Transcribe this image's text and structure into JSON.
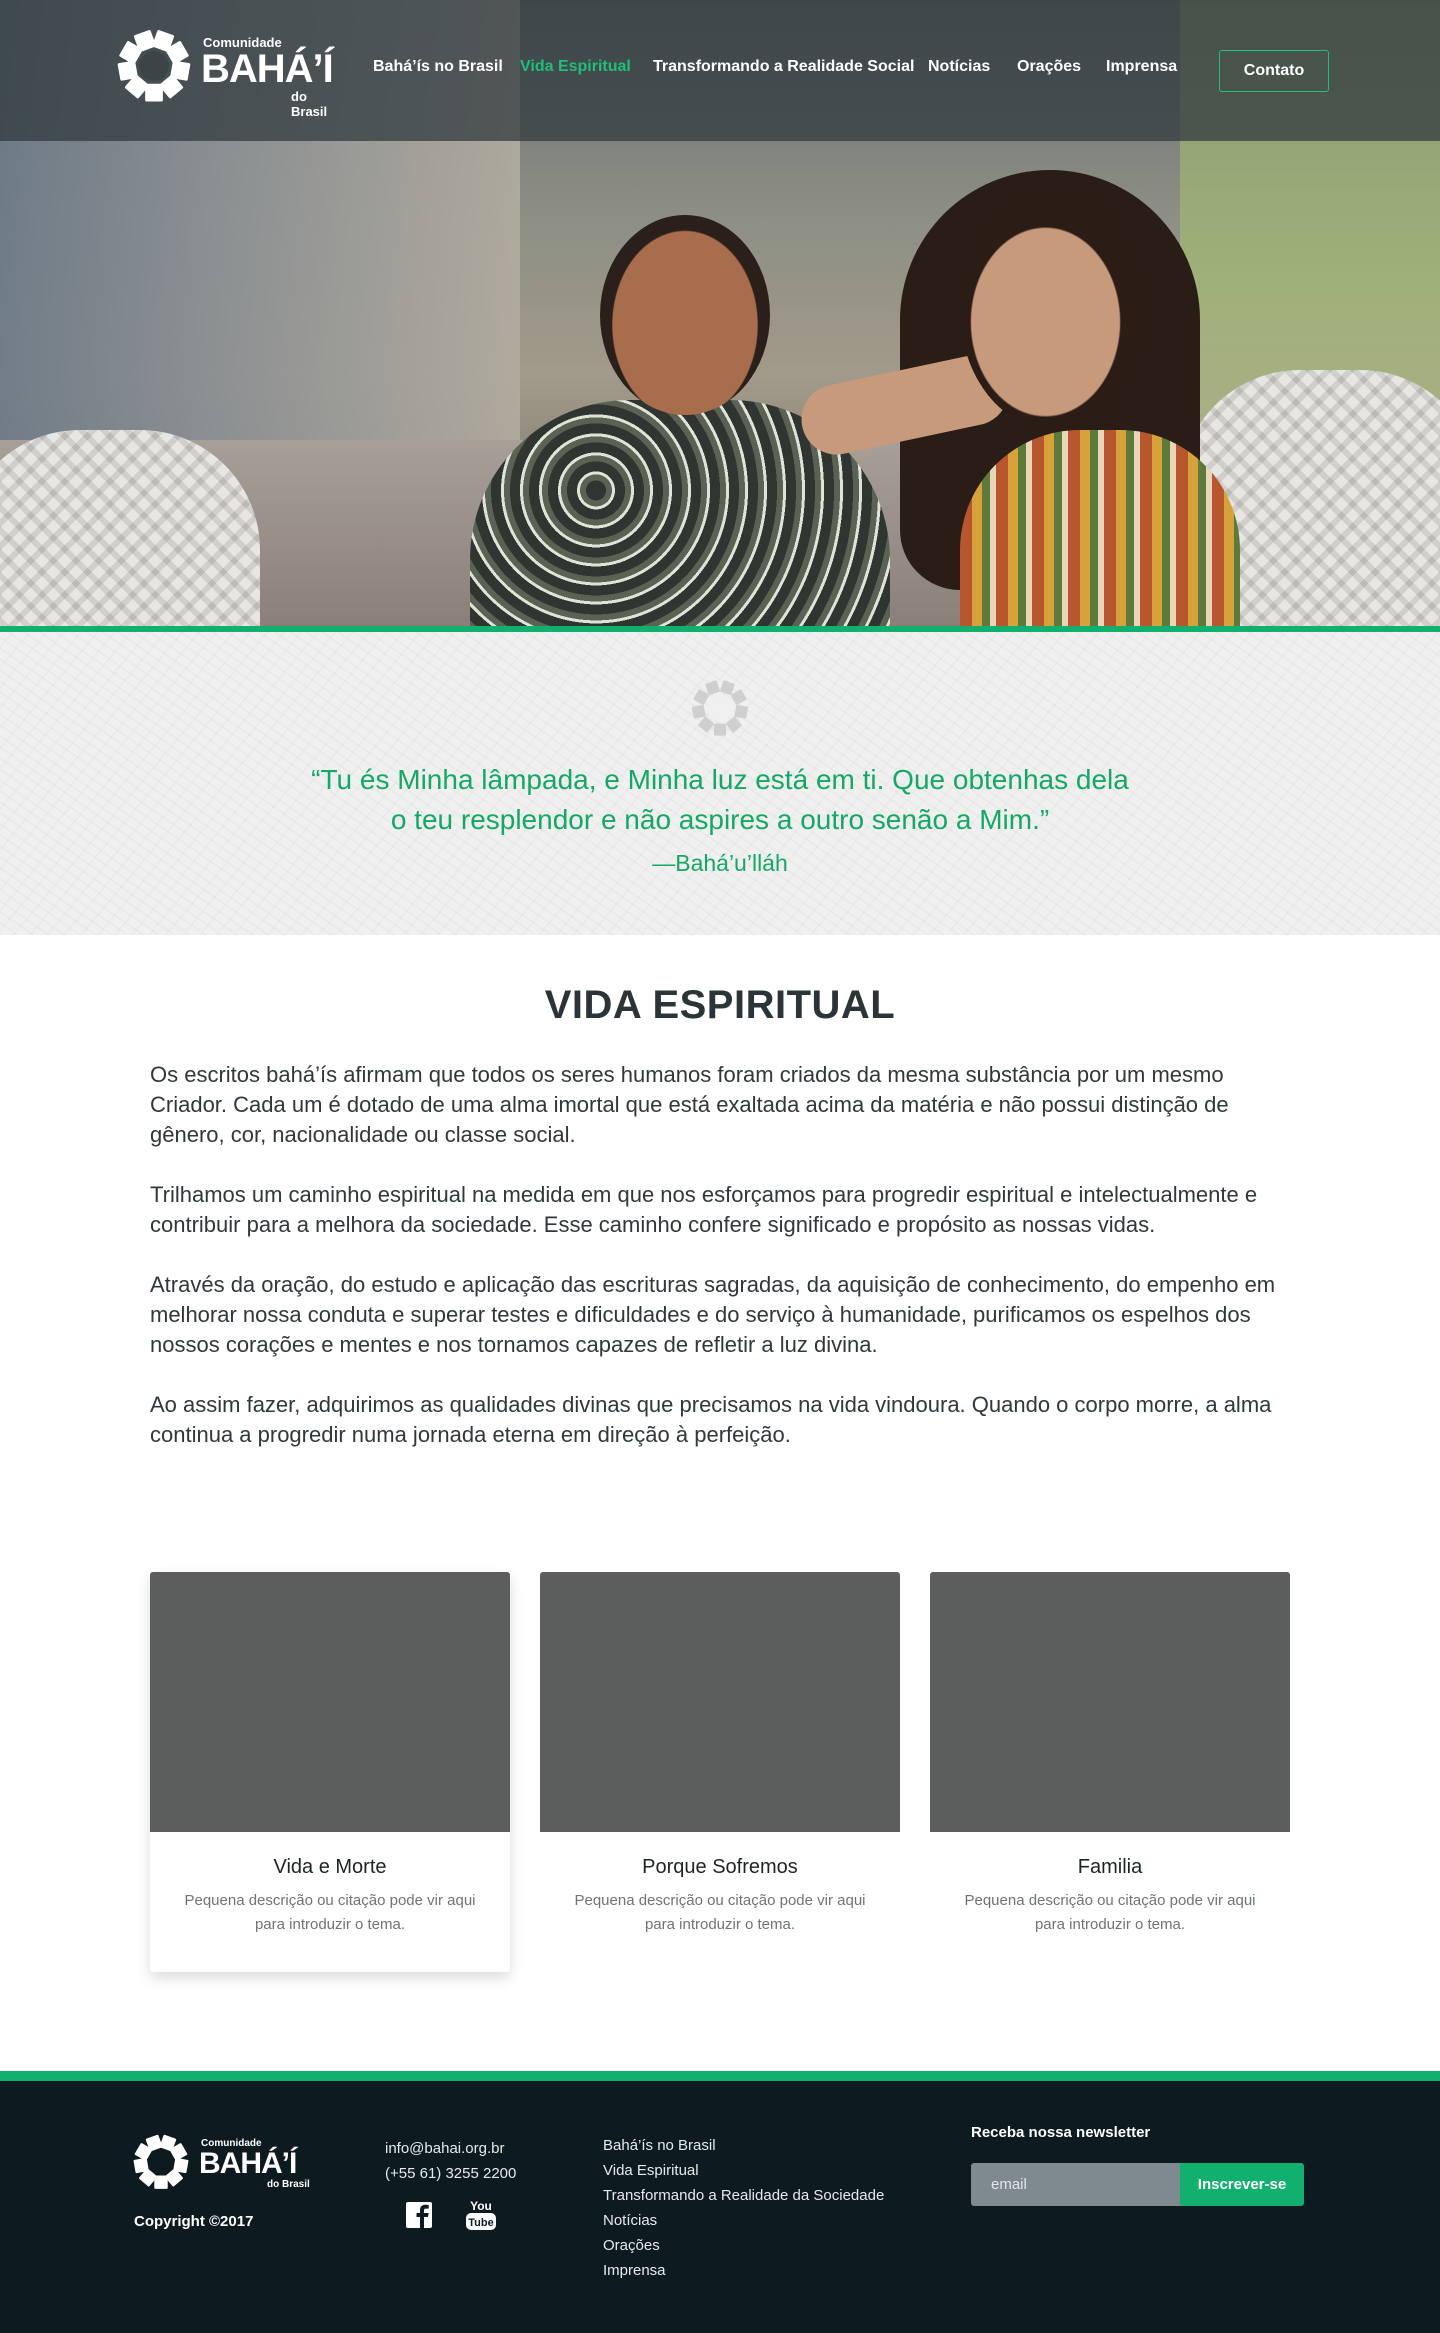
{
  "header": {
    "logo": {
      "top": "Comunidade",
      "main": "BAHÁ’Í",
      "bottom": "do Brasil"
    },
    "nav": [
      {
        "label": "Bahá’ís no Brasil",
        "active": false
      },
      {
        "label": "Vida Espiritual",
        "active": true
      },
      {
        "label": "Transformando a Realidade Social",
        "active": false
      },
      {
        "label": "Notícias",
        "active": false
      },
      {
        "label": "Orações",
        "active": false
      },
      {
        "label": "Imprensa",
        "active": false
      }
    ],
    "contact_button": "Contato"
  },
  "quote": {
    "text_line1": "“Tu és Minha lâmpada, e Minha luz está em ti. Que obtenhas dela",
    "text_line2": "o teu resplendor e não aspires a outro senão a Mim.”",
    "author": "—Bahá’u’lláh"
  },
  "main": {
    "title": "VIDA ESPIRITUAL",
    "paragraphs": [
      "Os escritos bahá’ís afirmam que todos os seres humanos foram criados da mesma substância por um mesmo Criador. Cada um é dotado de uma alma imortal que está exaltada acima da matéria e não possui distinção de gênero, cor, nacionalidade ou classe social.",
      "Trilhamos um caminho espiritual na medida em que nos esforçamos para progredir espiritual e intelectualmente e contribuir para a melhora da sociedade. Esse caminho confere significado e propósito as nossas vidas.",
      "Através da oração, do estudo e aplicação das escrituras sagradas, da aquisição de conhecimento, do empenho em melhorar nossa conduta e superar testes e dificuldades e do serviço à humanidade, purificamos os espelhos dos nossos corações e mentes e nos tornamos capazes de refletir a luz divina.",
      "Ao assim fazer, adquirimos as qualidades divinas que precisamos na vida vindoura. Quando o corpo morre, a alma continua a progredir numa jornada eterna em direção à perfeição."
    ],
    "cards": [
      {
        "title": "Vida e Morte",
        "desc": "Pequena descrição ou citação pode vir aqui para introduzir o tema."
      },
      {
        "title": "Porque Sofremos",
        "desc": "Pequena descrição ou citação pode vir aqui para introduzir o tema."
      },
      {
        "title": "Familia",
        "desc": "Pequena descrição ou citação pode vir aqui para introduzir o tema."
      }
    ]
  },
  "footer": {
    "logo": {
      "top": "Comunidade",
      "main": "BAHÁ’Í",
      "bottom": "do Brasil"
    },
    "copyright": "Copyright ©2017",
    "email": "info@bahai.org.br",
    "phone": "(+55 61) 3255 2200",
    "social": [
      "facebook-icon",
      "youtube-icon"
    ],
    "youtube_text_1": "You",
    "youtube_text_2": "Tube",
    "links": [
      "Bahá’ís no Brasil",
      "Vida Espiritual",
      "Transformando a Realidade da Sociedade",
      "Notícias",
      "Orações",
      "Imprensa"
    ],
    "newsletter": {
      "title": "Receba nossa newsletter",
      "placeholder": "email",
      "button": "Inscrever-se"
    }
  },
  "colors": {
    "accent": "#12b06e",
    "header_bg": "#2e383c",
    "footer_bg": "#0d1a1f",
    "text": "#2f383b"
  }
}
